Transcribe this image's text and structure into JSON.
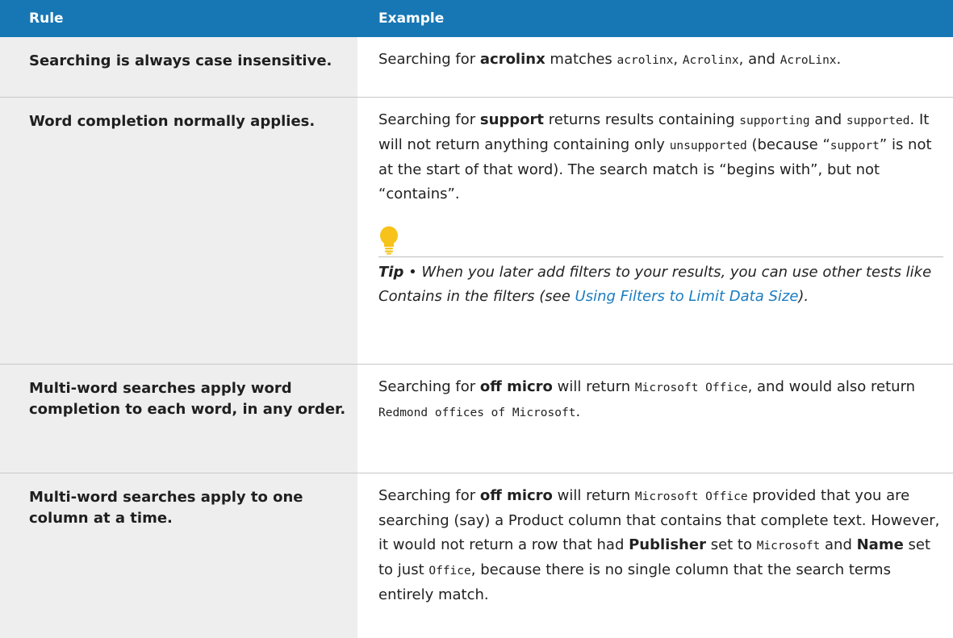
{
  "table": {
    "headers": {
      "rule": "Rule",
      "example": "Example"
    },
    "rows": [
      {
        "rule": "Searching is always case insensitive.",
        "ex": {
          "t1": "Searching for ",
          "b1": "acrolinx",
          "t2": " matches ",
          "c1": "acrolinx",
          "t3": ", ",
          "c2": "Acrolinx",
          "t4": ", and ",
          "c3": "AcroLinx",
          "t5": "."
        }
      },
      {
        "rule": "Word completion normally applies.",
        "ex": {
          "t1": "Searching for ",
          "b1": "support",
          "t2": " returns results containing ",
          "c1": "supporting",
          "t3": " and ",
          "c2": "supported",
          "t4": ". It will not return anything containing only ",
          "c3": "unsupported",
          "t5": " (because “",
          "c4": "support",
          "t6": "” is not at the start of that word). The search match is “begins with”, but not “contains”."
        },
        "tip": {
          "label": "Tip",
          "text": " • When you later add filters to your results, you can use other tests like Contains in the filters (see ",
          "link": "Using Filters to Limit Data Size",
          "end": ")."
        }
      },
      {
        "rule": "Multi-word searches apply word completion to each word, in any order.",
        "ex": {
          "t1": "Searching for ",
          "b1": "off micro",
          "t2": " will return ",
          "c1": "Microsoft Office",
          "t3": ", and would also return ",
          "c2": "Redmond offices of Microsoft",
          "t4": "."
        }
      },
      {
        "rule": "Multi-word searches apply to one column at a time.",
        "ex": {
          "t1": "Searching for ",
          "b1": "off micro",
          "t2": " will return ",
          "c1": "Microsoft Office",
          "t3": " provided that you are searching (say) a Product column that contains that complete text. However, it would not return a row that had ",
          "b2": "Publisher",
          "t4": " set to ",
          "c2": "Microsoft",
          "t5": " and ",
          "b3": "Name",
          "t6": " set to just ",
          "c3": "Office",
          "t7": ", because there is no single column that the search terms entirely match."
        }
      }
    ]
  },
  "colors": {
    "header_bg": "#1777b4",
    "rule_bg": "#eeeeee",
    "link": "#1a7cc1",
    "bulb": "#f7c31a"
  },
  "icons": {
    "tip": "lightbulb-icon"
  }
}
